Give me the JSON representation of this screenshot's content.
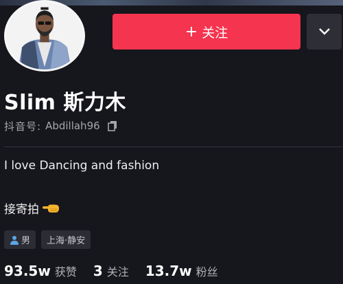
{
  "profile": {
    "name": "Slim 斯力木",
    "id_label": "抖音号:",
    "id_value": "Abdillah96",
    "bio_line1": "I love Dancing and fashion",
    "bio_line2": "接寄拍",
    "hand_emoji": "point-left-hand-icon"
  },
  "actions": {
    "follow_plus": "+",
    "follow_label": "关注",
    "more_icon": "chevron-down-icon"
  },
  "tags": [
    {
      "icon": "person-icon",
      "label": "男"
    },
    {
      "icon": "",
      "label": "上海·静安"
    }
  ],
  "stats": [
    {
      "value": "93.5w",
      "label": "获赞"
    },
    {
      "value": "3",
      "label": "关注"
    },
    {
      "value": "13.7w",
      "label": "粉丝"
    }
  ],
  "colors": {
    "background": "#16161d",
    "follow_button": "#f5344f",
    "secondary_text": "#a6a6ab",
    "tag_background": "#2c2c34"
  }
}
